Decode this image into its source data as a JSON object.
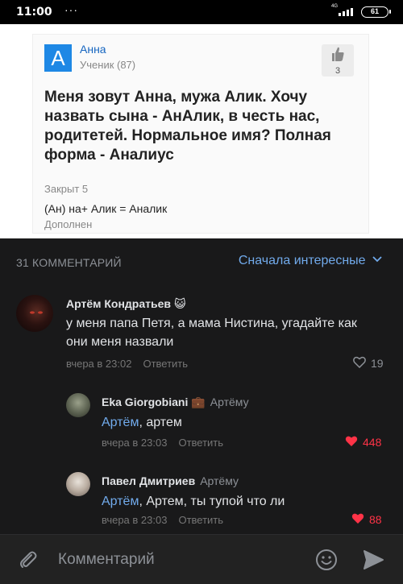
{
  "status_bar": {
    "time": "11:00",
    "dots": "···",
    "network": "4G",
    "battery": "61"
  },
  "post_image": {
    "avatar_letter": "А",
    "author": "Анна",
    "rank": "Ученик (87)",
    "like_count": "3",
    "question": "Меня зовут Анна, мужа Алик. Хочу назвать сына - АнАлик, в честь нас, родитетей. Нормальное имя? Полная форма - Аналиус",
    "closed": "Закрыт 5",
    "answer": "(Ан) на+ Алик = Аналик",
    "added": "Дополнен"
  },
  "comments": {
    "header": "31 КОММЕНТАРИЙ",
    "sort_label": "Сначала интересные",
    "items": [
      {
        "author": "Артём Кондратьев",
        "badge": "😺",
        "reply_to": "",
        "mention": "",
        "text": "у меня папа Петя, а мама Нистина, угадайте как они меня назвали",
        "time": "вчера в 23:02",
        "reply_label": "Ответить",
        "likes": "19",
        "liked": false
      },
      {
        "author": "Eka Giorgobiani",
        "badge": "💼",
        "reply_to": "Артёму",
        "mention": "Артём",
        "text": ", артем",
        "time": "вчера в 23:03",
        "reply_label": "Ответить",
        "likes": "448",
        "liked": true
      },
      {
        "author": "Павел Дмитриев",
        "badge": "",
        "reply_to": "Артёму",
        "mention": "Артём",
        "text": ", Артем, ты тупой что ли",
        "time": "вчера в 23:03",
        "reply_label": "Ответить",
        "likes": "88",
        "liked": true
      }
    ]
  },
  "input_bar": {
    "placeholder": "Комментарий"
  },
  "colors": {
    "accent_blue": "#71aaeb",
    "like_red": "#ff3347",
    "background": "#19191a"
  },
  "icons": [
    "paperclip-icon",
    "smile-icon",
    "send-icon",
    "heart-icon",
    "chevron-down-icon",
    "thumb-up-icon"
  ]
}
